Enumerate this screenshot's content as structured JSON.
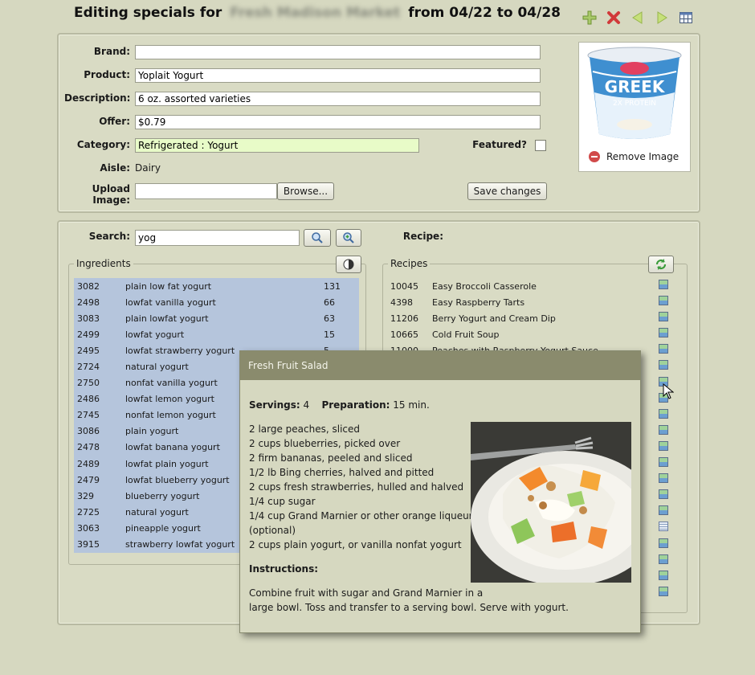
{
  "header": {
    "title_prefix": "Editing specials for",
    "store_name": "Fresh Madison Market",
    "title_suffix": "from 04/22 to 04/28"
  },
  "toolbar": {
    "add": "add-icon",
    "delete": "delete-icon",
    "prev": "prev-arrow-icon",
    "next": "next-arrow-icon",
    "grid": "grid-icon"
  },
  "form": {
    "brand_label": "Brand:",
    "brand_value": "",
    "product_label": "Product:",
    "product_value": "Yoplait Yogurt",
    "description_label": "Description:",
    "description_value": "6 oz. assorted varieties",
    "offer_label": "Offer:",
    "offer_value": "$0.79",
    "category_label": "Category:",
    "category_value": "Refrigerated : Yogurt",
    "featured_label": "Featured?",
    "aisle_label": "Aisle:",
    "aisle_value": "Dairy",
    "upload_label": "Upload Image:",
    "browse_button": "Browse...",
    "save_button": "Save changes",
    "remove_image": "Remove Image"
  },
  "search": {
    "label": "Search:",
    "value": "yog",
    "recipe_label": "Recipe:"
  },
  "ingredients": {
    "legend": "Ingredients",
    "rows": [
      {
        "id": "3082",
        "name": "plain low fat yogurt",
        "count": "131"
      },
      {
        "id": "2498",
        "name": "lowfat vanilla yogurt",
        "count": "66"
      },
      {
        "id": "3083",
        "name": "plain lowfat yogurt",
        "count": "63"
      },
      {
        "id": "2499",
        "name": "lowfat yogurt",
        "count": "15"
      },
      {
        "id": "2495",
        "name": "lowfat strawberry yogurt",
        "count": "5"
      },
      {
        "id": "2724",
        "name": "natural yogurt",
        "count": ""
      },
      {
        "id": "2750",
        "name": "nonfat vanilla yogurt",
        "count": ""
      },
      {
        "id": "2486",
        "name": "lowfat lemon yogurt",
        "count": ""
      },
      {
        "id": "2745",
        "name": "nonfat lemon yogurt",
        "count": ""
      },
      {
        "id": "3086",
        "name": "plain yogurt",
        "count": ""
      },
      {
        "id": "2478",
        "name": "lowfat banana yogurt",
        "count": ""
      },
      {
        "id": "2489",
        "name": "lowfat plain yogurt",
        "count": ""
      },
      {
        "id": "2479",
        "name": "lowfat blueberry yogurt",
        "count": ""
      },
      {
        "id": "329",
        "name": "blueberry yogurt",
        "count": ""
      },
      {
        "id": "2725",
        "name": "natural yogurt",
        "count": ""
      },
      {
        "id": "3063",
        "name": "pineapple yogurt",
        "count": ""
      },
      {
        "id": "3915",
        "name": "strawberry lowfat yogurt",
        "count": ""
      }
    ]
  },
  "recipes": {
    "legend": "Recipes",
    "rows": [
      {
        "id": "10045",
        "name": "Easy Broccoli Casserole"
      },
      {
        "id": "4398",
        "name": "Easy Raspberry Tarts"
      },
      {
        "id": "11206",
        "name": "Berry Yogurt and Cream Dip"
      },
      {
        "id": "10665",
        "name": "Cold Fruit Soup"
      },
      {
        "id": "11000",
        "name": "Peaches with Raspberry Yogurt Sauce"
      }
    ]
  },
  "popup": {
    "title": "Fresh Fruit Salad",
    "servings_label": "Servings:",
    "servings_value": "4",
    "prep_label": "Preparation:",
    "prep_value": "15 min.",
    "ingredients": [
      "2 large peaches, sliced",
      "2 cups blueberries, picked over",
      "2 firm bananas, peeled and sliced",
      "1/2 lb Bing cherries, halved and pitted",
      "2 cups fresh strawberries, hulled and halved",
      "1/4 cup sugar",
      "1/4 cup Grand Marnier or other orange liqueur",
      "(optional)",
      "2 cups plain yogurt, or vanilla nonfat yogurt"
    ],
    "instructions_label": "Instructions:",
    "instructions_line1": "Combine fruit with sugar and Grand Marnier in a",
    "instructions_line2": "large bowl. Toss and transfer to a serving bowl. Serve with yogurt."
  }
}
